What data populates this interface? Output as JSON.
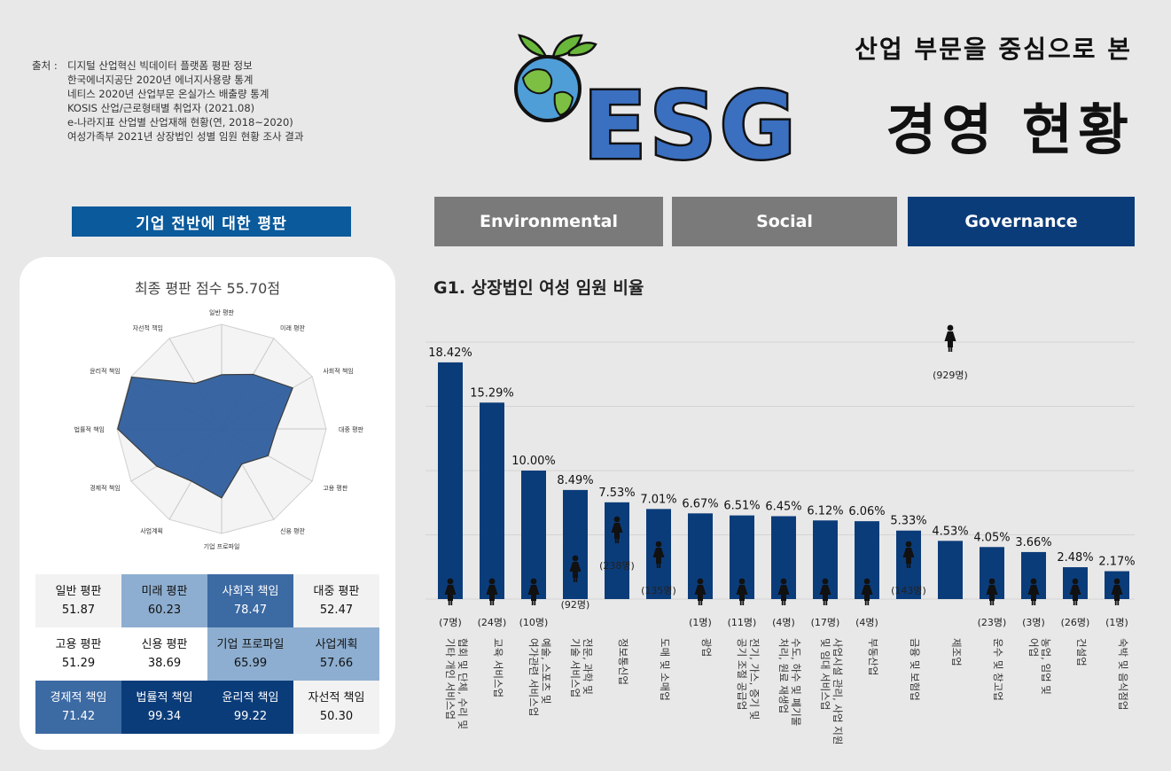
{
  "sources": {
    "prefix": "출처 :",
    "items": [
      "디지털 산업혁신 빅데이터 플랫폼 평판 정보",
      "한국에너지공단 2020년 에너지사용량 통계",
      "네티스 2020년 산업부문 온실가스 배출량 통계",
      "KOSIS 산업/근로형태별 취업자 (2021.08)",
      "e-나라지표 산업별 산업재해 현황(연, 2018~2020)",
      "여성가족부 2021년 상장법인 성별 임원 현황 조사 결과"
    ]
  },
  "header": {
    "logo_text": "ESG",
    "subtitle": "산업 부문을 중심으로 본",
    "title": "경영 현황"
  },
  "left": {
    "section_title": "기업 전반에 대한 평판",
    "radar_title": "최종 평판 점수 55.70점",
    "radar_axes": [
      "일반 평판",
      "미래 평판",
      "사회적 책임",
      "대중 평판",
      "고용 평판",
      "신용 평판",
      "기업 프로파일",
      "사업계획",
      "경제적 책임",
      "법률적 책임",
      "윤리적 책임",
      "자선적 책임"
    ],
    "radar_values": [
      51.87,
      60.23,
      78.47,
      52.47,
      51.29,
      38.69,
      65.99,
      57.66,
      71.42,
      99.34,
      99.22,
      50.3
    ],
    "scores": [
      {
        "label": "일반 평판",
        "value": "51.87",
        "bg": "#f2f2f2",
        "fg": "#111"
      },
      {
        "label": "미래 평판",
        "value": "60.23",
        "bg": "#8daed0",
        "fg": "#111"
      },
      {
        "label": "사회적 책임",
        "value": "78.47",
        "bg": "#3c6aa3",
        "fg": "#ffffff"
      },
      {
        "label": "대중 평판",
        "value": "52.47",
        "bg": "#f2f2f2",
        "fg": "#111"
      },
      {
        "label": "고용 평판",
        "value": "51.29",
        "bg": "#ffffff",
        "fg": "#111"
      },
      {
        "label": "신용 평판",
        "value": "38.69",
        "bg": "#ffffff",
        "fg": "#111"
      },
      {
        "label": "기업 프로파일",
        "value": "65.99",
        "bg": "#8daed0",
        "fg": "#111"
      },
      {
        "label": "사업계획",
        "value": "57.66",
        "bg": "#8daed0",
        "fg": "#111"
      },
      {
        "label": "경제적 책임",
        "value": "71.42",
        "bg": "#3c6aa3",
        "fg": "#ffffff"
      },
      {
        "label": "법률적 책임",
        "value": "99.34",
        "bg": "#0b3c7a",
        "fg": "#ffffff"
      },
      {
        "label": "윤리적 책임",
        "value": "99.22",
        "bg": "#0b3c7a",
        "fg": "#ffffff"
      },
      {
        "label": "자선적 책임",
        "value": "50.30",
        "bg": "#f2f2f2",
        "fg": "#111"
      }
    ]
  },
  "tabs": [
    {
      "label": "Environmental",
      "active": false
    },
    {
      "label": "Social",
      "active": false
    },
    {
      "label": "Governance",
      "active": true
    }
  ],
  "chart_title": "G1. 상장법인 여성 임원 비율",
  "chart_data": {
    "type": "bar",
    "categories": [
      "협회 및 단체, 수리 및 기타 개인 서비스업",
      "교육 서비스업",
      "예술, 스포츠 및 여가관련 서비스업",
      "전문, 과학 및 기술 서비스업",
      "정보통신업",
      "도매 및 소매업",
      "광업",
      "전기, 가스, 증기 및 공기 조절 공급업",
      "수도, 하수 및 폐기물 처리, 원료 재생업",
      "사업시설 관리, 사업 지원 및 임대 서비스업",
      "부동산업",
      "금융 및 보험업",
      "제조업",
      "운수 및 창고업",
      "농업, 임업 및 어업",
      "건설업",
      "숙박 및 음식점업"
    ],
    "values": [
      18.42,
      15.29,
      10.0,
      8.49,
      7.53,
      7.01,
      6.67,
      6.51,
      6.45,
      6.12,
      6.06,
      5.33,
      4.53,
      4.05,
      3.66,
      2.48,
      2.17
    ],
    "value_labels": [
      "18.42%",
      "15.29%",
      "10.00%",
      "8.49%",
      "7.53%",
      "7.01%",
      "6.67%",
      "6.51%",
      "6.45%",
      "6.12%",
      "6.06%",
      "5.33%",
      "4.53%",
      "4.05%",
      "3.66%",
      "2.48%",
      "2.17%"
    ],
    "counts": [
      "(7명)",
      "(24명)",
      "(10명)",
      "(92명)",
      "(238명)",
      "(135명)",
      "(1명)",
      "(11명)",
      "(4명)",
      "(17명)",
      "(4명)",
      "(143명)",
      "(929명)",
      "(23명)",
      "(3명)",
      "(26명)",
      "(1명)"
    ],
    "ylim": [
      0,
      20
    ],
    "bar_color": "#0b3c7a",
    "icon": "woman-icon"
  }
}
